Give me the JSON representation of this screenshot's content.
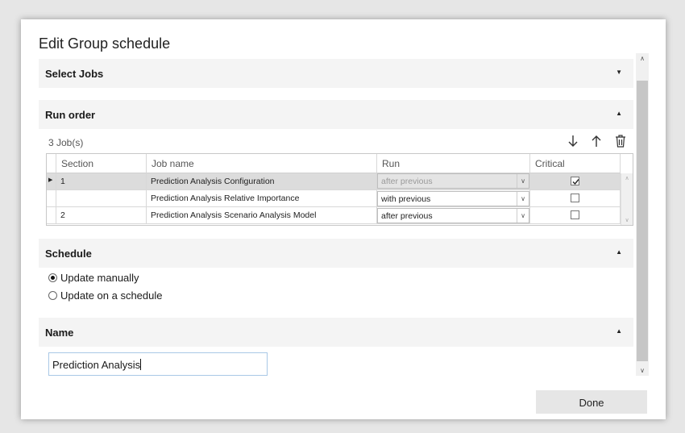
{
  "dialog": {
    "title": "Edit Group schedule"
  },
  "sections": {
    "select_jobs": {
      "label": "Select Jobs",
      "state": "collapsed"
    },
    "run_order": {
      "label": "Run order",
      "state": "expanded"
    },
    "schedule": {
      "label": "Schedule",
      "state": "expanded"
    },
    "name": {
      "label": "Name",
      "state": "expanded"
    }
  },
  "run_order": {
    "jobs_count": "3 Job(s)",
    "columns": [
      "Section",
      "Job name",
      "Run",
      "Critical"
    ],
    "rows": [
      {
        "section": "1",
        "job_name": "Prediction Analysis Configuration",
        "run": "after previous",
        "run_disabled": true,
        "critical": true,
        "current": true
      },
      {
        "section": "",
        "job_name": "Prediction Analysis Relative Importance",
        "run": "with previous",
        "run_disabled": false,
        "critical": false,
        "current": false
      },
      {
        "section": "2",
        "job_name": "Prediction Analysis Scenario Analysis Model",
        "run": "after previous",
        "run_disabled": false,
        "critical": false,
        "current": false
      }
    ],
    "toolbar": [
      "move-down-icon",
      "move-up-icon",
      "trash-icon"
    ]
  },
  "schedule": {
    "options": [
      {
        "label": "Update manually",
        "selected": true
      },
      {
        "label": "Update on a schedule",
        "selected": false
      }
    ]
  },
  "name": {
    "value": "Prediction Analysis"
  },
  "footer": {
    "done_label": "Done"
  },
  "colors": {
    "header_bg": "#f4f4f4",
    "input_border": "#a9c8e6",
    "button_bg": "#e6e6e6",
    "selected_row": "#dcdcdc"
  }
}
